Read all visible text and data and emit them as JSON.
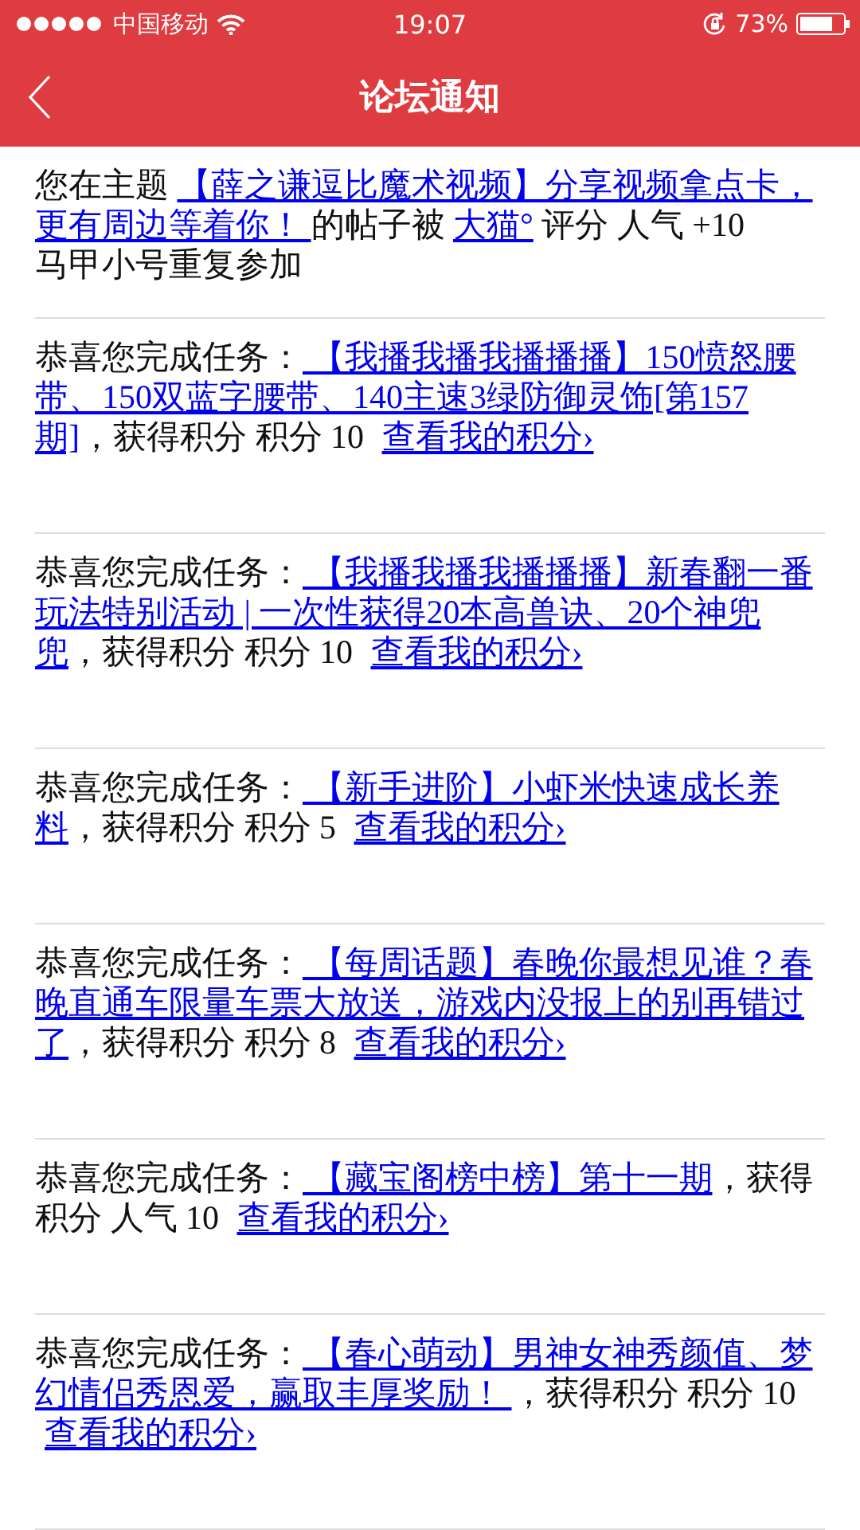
{
  "status_bar": {
    "carrier": "中国移动",
    "time": "19:07",
    "battery": "73%"
  },
  "nav": {
    "title": "论坛通知"
  },
  "notices": [
    {
      "parts": [
        {
          "kind": "text",
          "text": "您在主题 "
        },
        {
          "kind": "link",
          "text": " 【薛之谦逗比魔术视频】分享视频拿点卡，更有周边等着你！ "
        },
        {
          "kind": "text",
          "text": " 的帖子被 "
        },
        {
          "kind": "link",
          "text": "大猫°"
        },
        {
          "kind": "text",
          "text": " 评分 人气 +10"
        }
      ],
      "note": "马甲小号重复参加"
    },
    {
      "parts": [
        {
          "kind": "text",
          "text": "恭喜您完成任务："
        },
        {
          "kind": "link",
          "text": " 【我播我播我播播播】150愤怒腰带、150双蓝字腰带、140主速3绿防御灵饰[第157期]"
        },
        {
          "kind": "text",
          "text": "，获得积分 积分 10 "
        },
        {
          "kind": "action",
          "text": "查看我的积分›"
        }
      ]
    },
    {
      "parts": [
        {
          "kind": "text",
          "text": "恭喜您完成任务："
        },
        {
          "kind": "link",
          "text": " 【我播我播我播播播】新春翻一番玩法特别活动 | 一次性获得20本高兽诀、20个神兜兜"
        },
        {
          "kind": "text",
          "text": "，获得积分 积分 10 "
        },
        {
          "kind": "action",
          "text": "查看我的积分›"
        }
      ]
    },
    {
      "parts": [
        {
          "kind": "text",
          "text": "恭喜您完成任务："
        },
        {
          "kind": "link",
          "text": " 【新手进阶】小虾米快速成长养料"
        },
        {
          "kind": "text",
          "text": "，获得积分 积分 5 "
        },
        {
          "kind": "action",
          "text": "查看我的积分›"
        }
      ]
    },
    {
      "parts": [
        {
          "kind": "text",
          "text": "恭喜您完成任务："
        },
        {
          "kind": "link",
          "text": " 【每周话题】春晚你最想见谁？春晚直通车限量车票大放送，游戏内没报上的别再错过了"
        },
        {
          "kind": "text",
          "text": "，获得积分 积分 8 "
        },
        {
          "kind": "action",
          "text": "查看我的积分›"
        }
      ]
    },
    {
      "parts": [
        {
          "kind": "text",
          "text": "恭喜您完成任务："
        },
        {
          "kind": "link",
          "text": " 【藏宝阁榜中榜】第十一期"
        },
        {
          "kind": "text",
          "text": "，获得积分 人气 10 "
        },
        {
          "kind": "action",
          "text": "查看我的积分›"
        }
      ]
    },
    {
      "parts": [
        {
          "kind": "text",
          "text": "恭喜您完成任务："
        },
        {
          "kind": "link",
          "text": " 【春心萌动】男神女神秀颜值、梦幻情侣秀恩爱，赢取丰厚奖励！ "
        },
        {
          "kind": "text",
          "text": "，获得积分 积分 10 "
        },
        {
          "kind": "action",
          "text": "查看我的积分›"
        }
      ]
    }
  ]
}
